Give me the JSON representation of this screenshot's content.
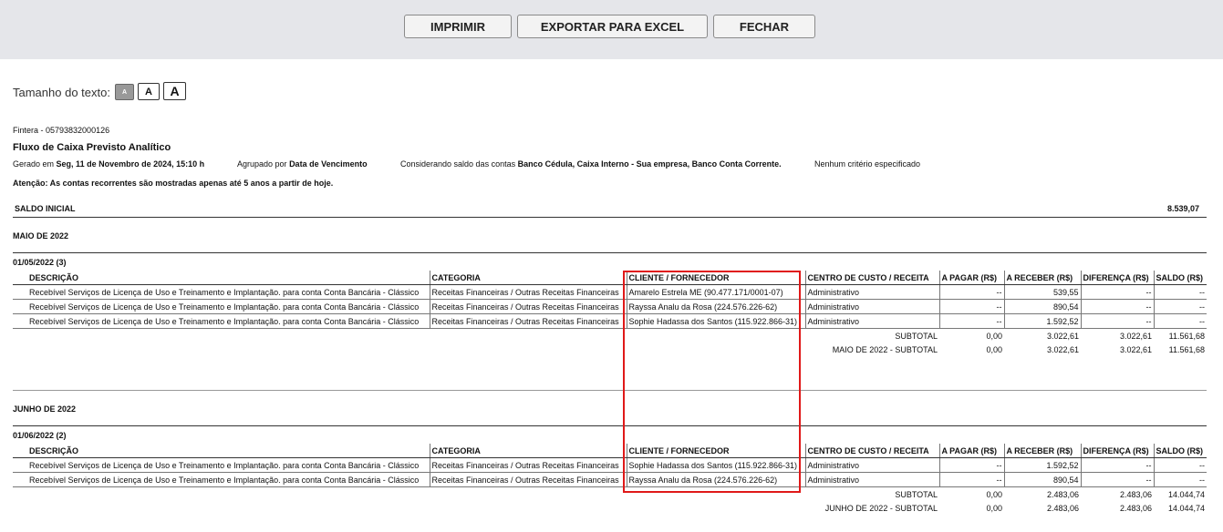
{
  "toolbar": {
    "print": "IMPRIMIR",
    "export": "EXPORTAR PARA EXCEL",
    "close": "FECHAR"
  },
  "text_size": {
    "label": "Tamanho do texto:",
    "small": "A",
    "medium": "A",
    "large": "A"
  },
  "report": {
    "company": "Fintera - 05793832000126",
    "title": "Fluxo de Caixa Previsto Analítico",
    "generated_prefix": "Gerado em",
    "generated_value": "Seg, 11 de Novembro de 2024, 15:10 h",
    "grouped_prefix": "Agrupado por",
    "grouped_value": "Data de Vencimento",
    "balance_prefix": "Considerando saldo das contas",
    "balance_value": "Banco Cédula, Caixa Interno - Sua empresa, Banco Conta Corrente.",
    "criteria": "Nenhum critério especificado",
    "warning": "Atenção: As contas recorrentes são mostradas apenas até 5 anos a partir de hoje.",
    "initial_balance_label": "SALDO INICIAL",
    "initial_balance_value": "8.539,07"
  },
  "columns": {
    "descricao": "DESCRIÇÃO",
    "categoria": "CATEGORIA",
    "cliente": "CLIENTE / FORNECEDOR",
    "centro": "CENTRO DE CUSTO / RECEITA",
    "pagar": "A PAGAR (R$)",
    "receber": "A RECEBER (R$)",
    "diferenca": "DIFERENÇA (R$)",
    "saldo": "SALDO (R$)"
  },
  "months": [
    {
      "title": "MAIO DE 2022",
      "date": "01/05/2022 (3)",
      "rows": [
        {
          "descricao": "Recebível Serviços de Licença de Uso e Treinamento e Implantação. para conta Conta Bancária - Clássico",
          "categoria": "Receitas Financeiras / Outras Receitas Financeiras",
          "cliente": "Amarelo Estrela ME (90.477.171/0001-07)",
          "centro": "Administrativo",
          "pagar": "--",
          "receber": "539,55",
          "diferenca": "--",
          "saldo": "--"
        },
        {
          "descricao": "Recebível Serviços de Licença de Uso e Treinamento e Implantação. para conta Conta Bancária - Clássico",
          "categoria": "Receitas Financeiras / Outras Receitas Financeiras",
          "cliente": "Rayssa Analu da Rosa (224.576.226-62)",
          "centro": "Administrativo",
          "pagar": "--",
          "receber": "890,54",
          "diferenca": "--",
          "saldo": "--"
        },
        {
          "descricao": "Recebível Serviços de Licença de Uso e Treinamento e Implantação. para conta Conta Bancária - Clássico",
          "categoria": "Receitas Financeiras / Outras Receitas Financeiras",
          "cliente": "Sophie Hadassa dos Santos (115.922.866-31)",
          "centro": "Administrativo",
          "pagar": "--",
          "receber": "1.592,52",
          "diferenca": "--",
          "saldo": "--"
        }
      ],
      "subtotal": {
        "label": "SUBTOTAL",
        "pagar": "0,00",
        "receber": "3.022,61",
        "diferenca": "3.022,61",
        "saldo": "11.561,68"
      },
      "month_subtotal": {
        "label": "MAIO DE 2022 - SUBTOTAL",
        "pagar": "0,00",
        "receber": "3.022,61",
        "diferenca": "3.022,61",
        "saldo": "11.561,68"
      }
    },
    {
      "title": "JUNHO DE 2022",
      "date": "01/06/2022 (2)",
      "rows": [
        {
          "descricao": "Recebível Serviços de Licença de Uso e Treinamento e Implantação. para conta Conta Bancária - Clássico",
          "categoria": "Receitas Financeiras / Outras Receitas Financeiras",
          "cliente": "Sophie Hadassa dos Santos (115.922.866-31)",
          "centro": "Administrativo",
          "pagar": "--",
          "receber": "1.592,52",
          "diferenca": "--",
          "saldo": "--"
        },
        {
          "descricao": "Recebível Serviços de Licença de Uso e Treinamento e Implantação. para conta Conta Bancária - Clássico",
          "categoria": "Receitas Financeiras / Outras Receitas Financeiras",
          "cliente": "Rayssa Analu da Rosa (224.576.226-62)",
          "centro": "Administrativo",
          "pagar": "--",
          "receber": "890,54",
          "diferenca": "--",
          "saldo": "--"
        }
      ],
      "subtotal": {
        "label": "SUBTOTAL",
        "pagar": "0,00",
        "receber": "2.483,06",
        "diferenca": "2.483,06",
        "saldo": "14.044,74"
      },
      "month_subtotal": {
        "label": "JUNHO DE 2022 - SUBTOTAL",
        "pagar": "0,00",
        "receber": "2.483,06",
        "diferenca": "2.483,06",
        "saldo": "14.044,74"
      }
    }
  ]
}
